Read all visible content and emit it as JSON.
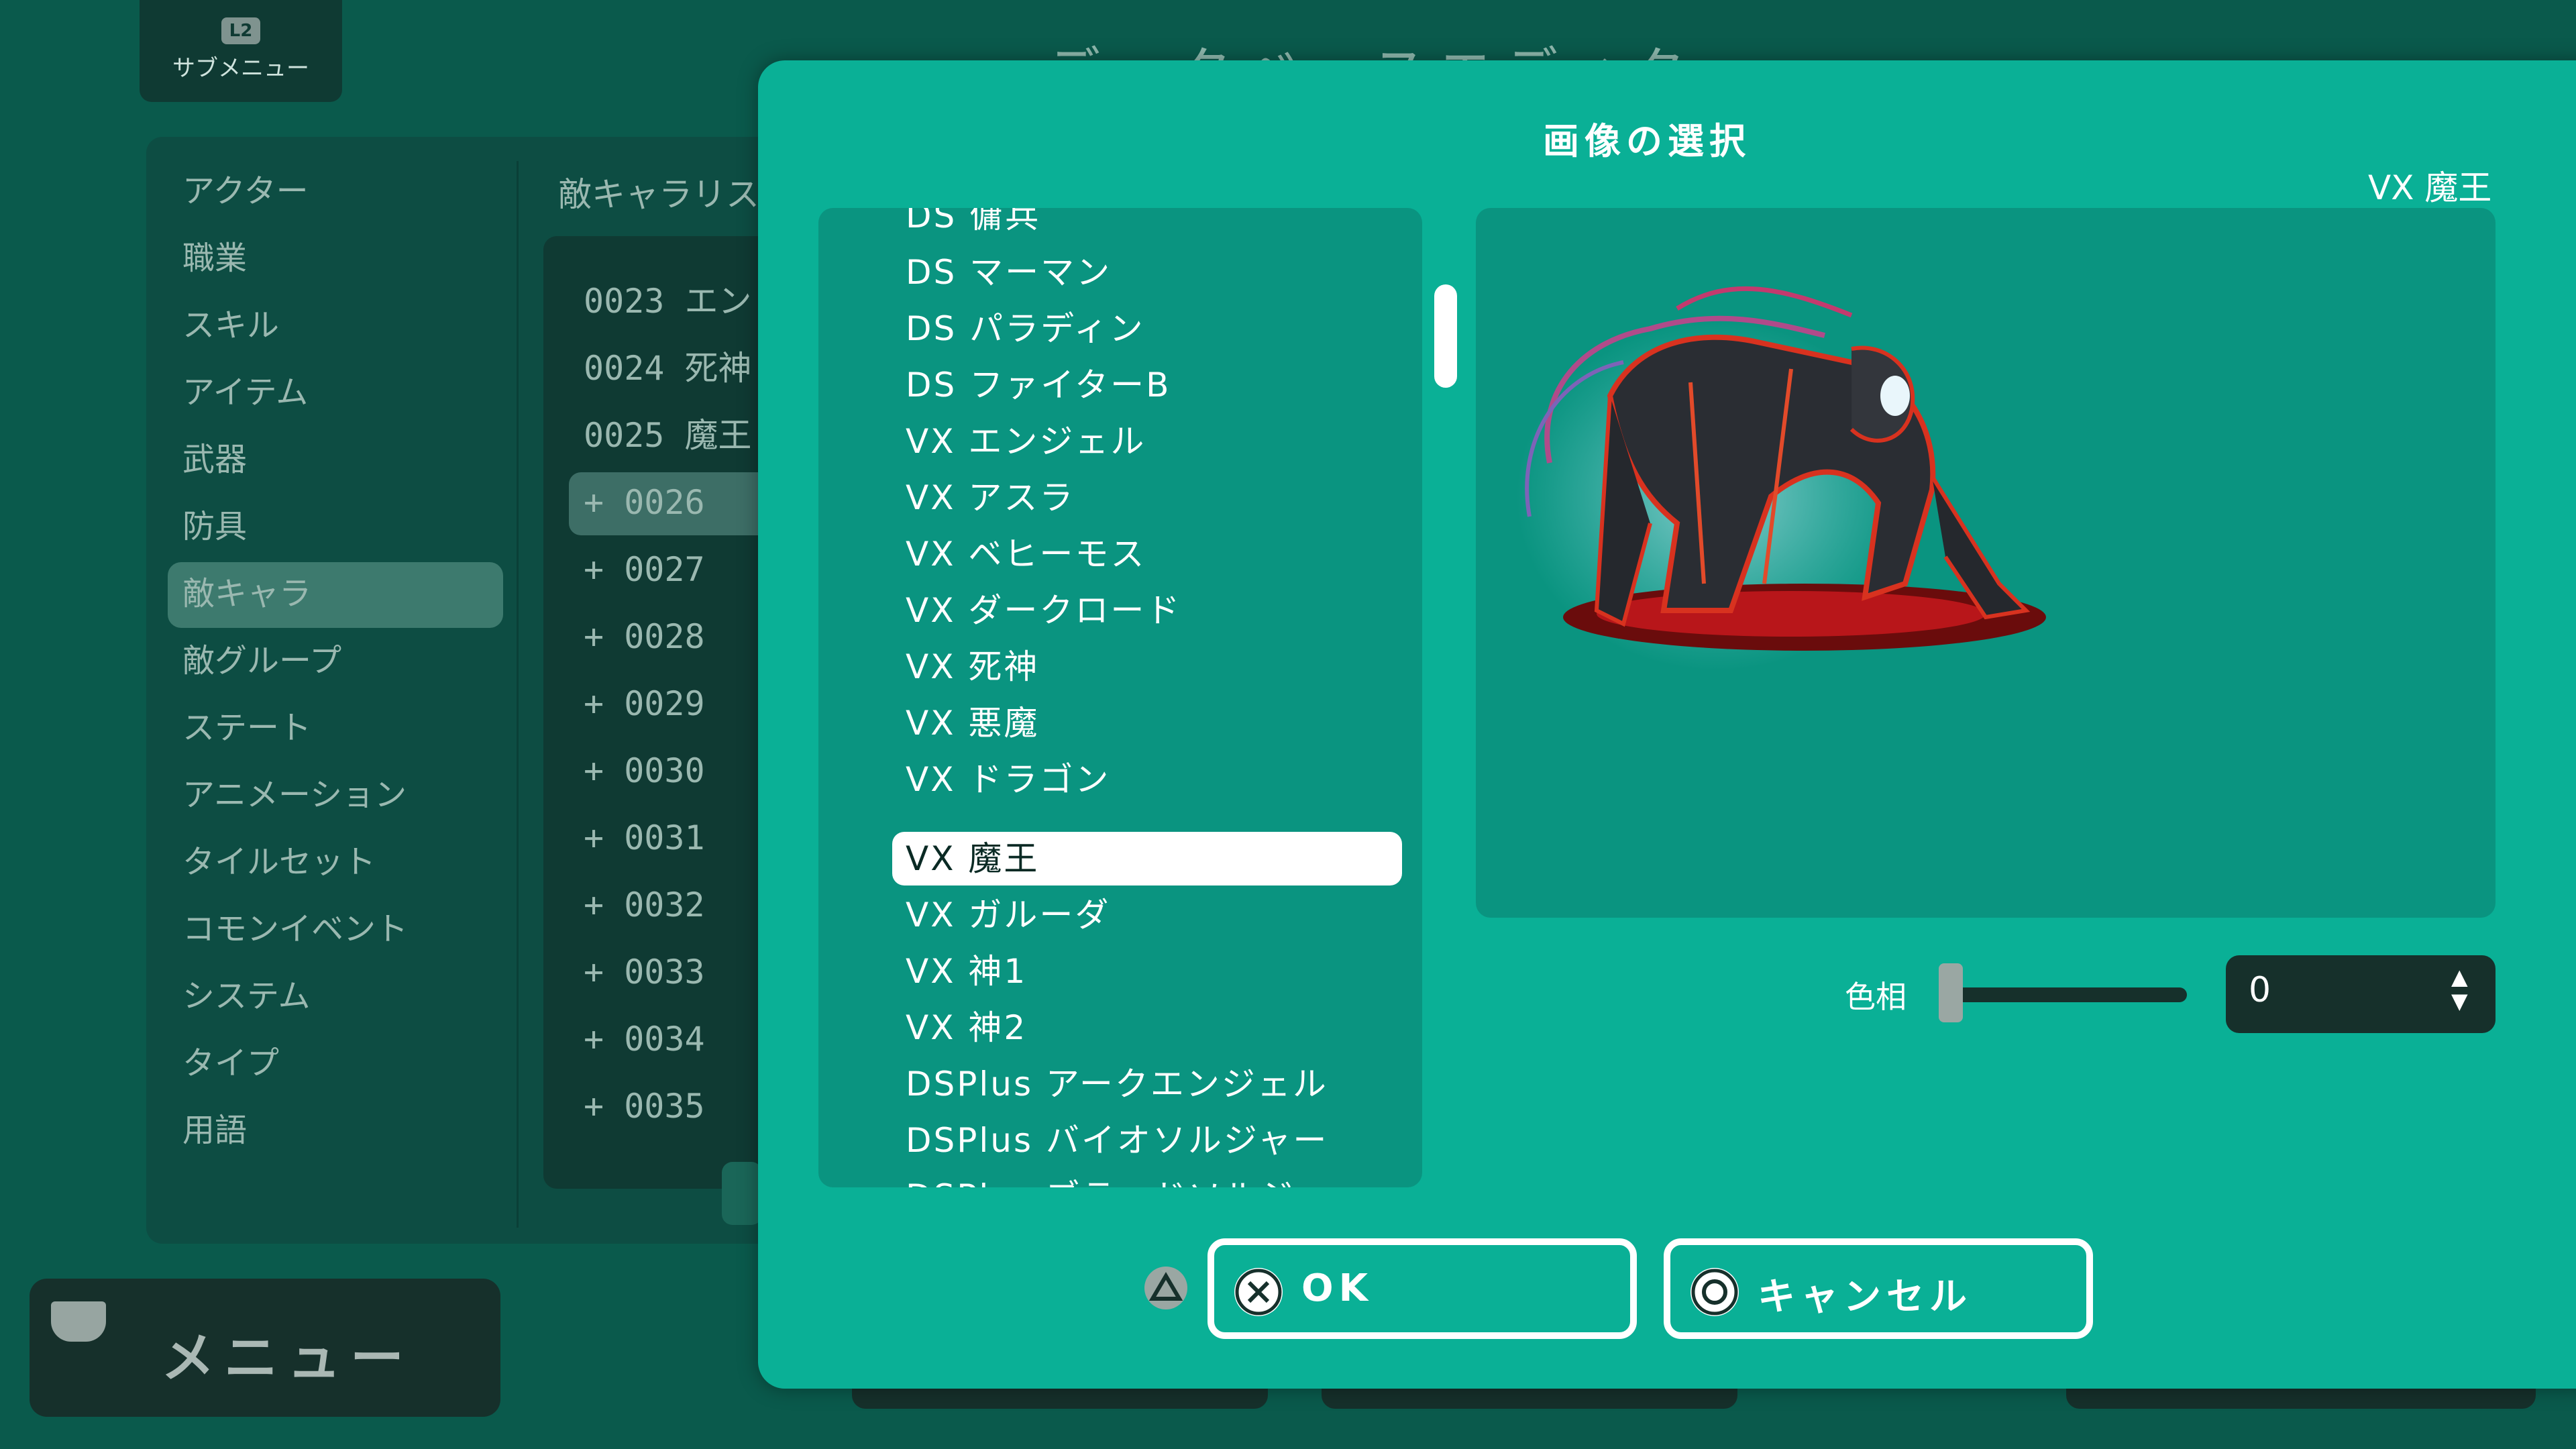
{
  "background": {
    "submenu_label": "サブメニュー",
    "submenu_key": "L2",
    "title": "データベースエディタ",
    "categories": [
      "アクター",
      "職業",
      "スキル",
      "アイテム",
      "武器",
      "防具",
      "敵キャラ",
      "敵グループ",
      "ステート",
      "アニメーション",
      "タイルセット",
      "コモンイベント",
      "システム",
      "タイプ",
      "用語"
    ],
    "selected_category": "敵キャラ",
    "list_header": "敵キャラリスト",
    "list_rows": [
      "0023 エン",
      "0024 死神",
      "0025 魔王",
      "+ 0026",
      "+ 0027",
      "+ 0028",
      "+ 0029",
      "+ 0030",
      "+ 0031",
      "+ 0032",
      "+ 0033",
      "+ 0034",
      "+ 0035"
    ],
    "menu_label": "メニュー"
  },
  "dialog": {
    "title": "画像の選択",
    "selected_name": "VX 魔王",
    "files": [
      "DS 傭兵",
      "DS マーマン",
      "DS パラディン",
      "DS ファイターB",
      "VX エンジェル",
      "VX アスラ",
      "VX ベヒーモス",
      "VX ダークロード",
      "VX 死神",
      "VX 悪魔",
      "VX ドラゴン",
      "VX 魔王",
      "VX ガルーダ",
      "VX 神1",
      "VX 神2",
      "DSPlus アークエンジェル",
      "DSPlus バイオソルジャー",
      "DSPlus ブラッドソルジャー"
    ],
    "selected_index": 11,
    "hue_label": "色相",
    "hue_value": "0",
    "hue_level": 0,
    "ok_label": "OK",
    "cancel_label": "キャンセル",
    "colors": {
      "accent": "#0ab096",
      "panel": "#0a9480",
      "dark": "#16302b"
    }
  }
}
